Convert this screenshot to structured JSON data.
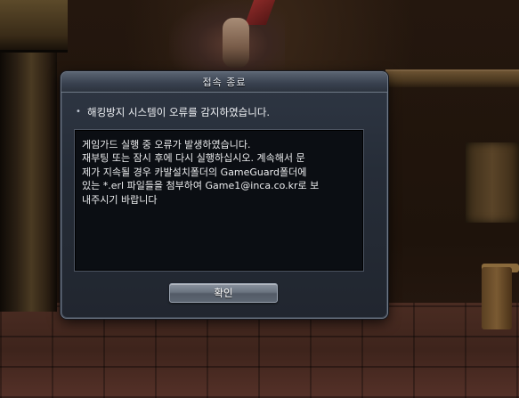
{
  "dialog": {
    "title": "접속 종료",
    "message": "해킹방지 시스템이 오류를 감지하였습니다.",
    "bullet_icon": "•",
    "detail_lines": [
      "게임가드 실행 중 오류가 발생하였습니다.",
      "재부팅 또는 잠시 후에 다시 실행하십시오. 계속해서 문",
      "제가 지속될 경우 카발설치폴더의 GameGuard폴더에",
      "있는 *.erl 파일들을 첨부하여 Game1@inca.co.kr로 보",
      "내주시기 바랍니다"
    ],
    "confirm_label": "확인"
  },
  "colors": {
    "dialog_background": "#262d38",
    "detail_background": "#0b0e13",
    "button": "#6b7480",
    "text": "#f0f2f5"
  }
}
